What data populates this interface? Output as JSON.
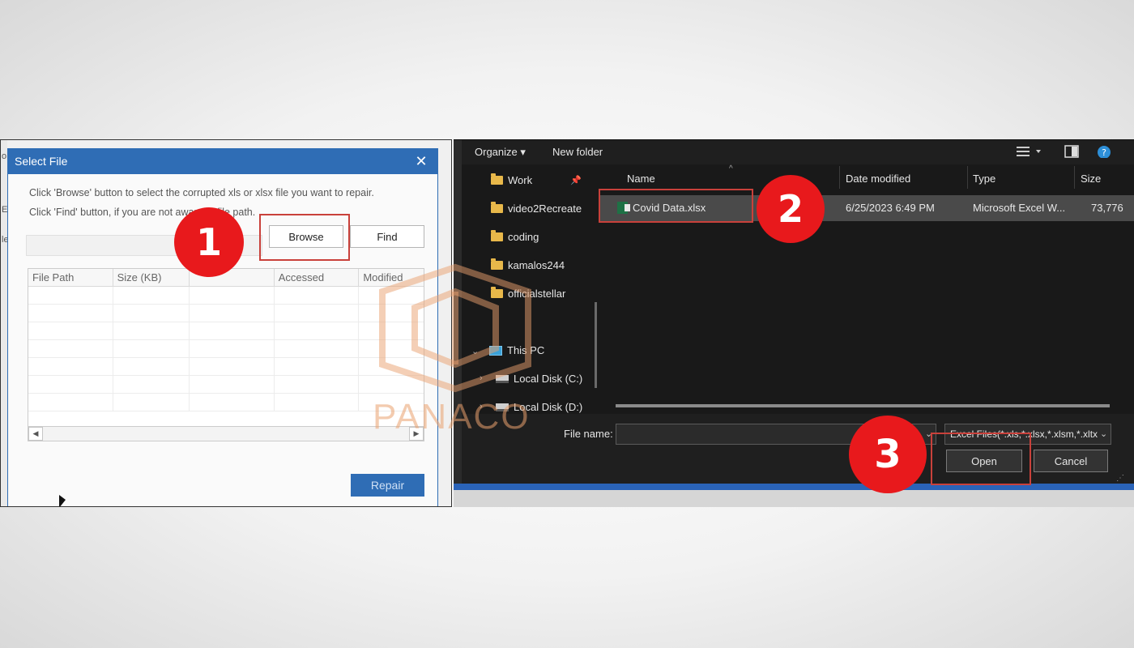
{
  "left_dialog": {
    "title": "Select File",
    "close_glyph": "✕",
    "instruction_1": "Click 'Browse' button to select the corrupted xls or xlsx file you want to repair.",
    "instruction_2": "Click 'Find' button, if you are not aware of file path.",
    "browse_label": "Browse",
    "find_label": "Find",
    "columns": [
      "File Path",
      "Size (KB)",
      "",
      "Accessed",
      "Modified"
    ],
    "scroll_left": "◀",
    "scroll_right": "▶",
    "repair_label": "Repair",
    "edge_glyphs": [
      "o",
      "E",
      "le"
    ]
  },
  "file_dialog": {
    "organize_label": "Organize ▾",
    "new_folder_label": "New folder",
    "nav_items": [
      "Work",
      "video2Recreate",
      "coding",
      "kamalos244",
      "officialstellar"
    ],
    "this_pc": "This PC",
    "drives": [
      "Local Disk (C:)",
      "Local Disk (D:)"
    ],
    "columns": {
      "name": "Name",
      "date": "Date modified",
      "type": "Type",
      "size": "Size"
    },
    "file": {
      "name": "Covid Data.xlsx",
      "date": "6/25/2023 6:49 PM",
      "type": "Microsoft Excel W...",
      "size": "73,776"
    },
    "file_name_label": "File name:",
    "file_type_value": "Excel Files(*.xls,*.xlsx,*.xlsm,*.xltx",
    "open_label": "Open",
    "cancel_label": "Cancel"
  },
  "steps": [
    "1",
    "2",
    "3"
  ],
  "watermark": "PANACO",
  "colors": {
    "step_badge": "#e8191c",
    "highlight_box": "#c9413b",
    "dialog_blue": "#2f6db5",
    "watermark": "#e9a06e"
  }
}
